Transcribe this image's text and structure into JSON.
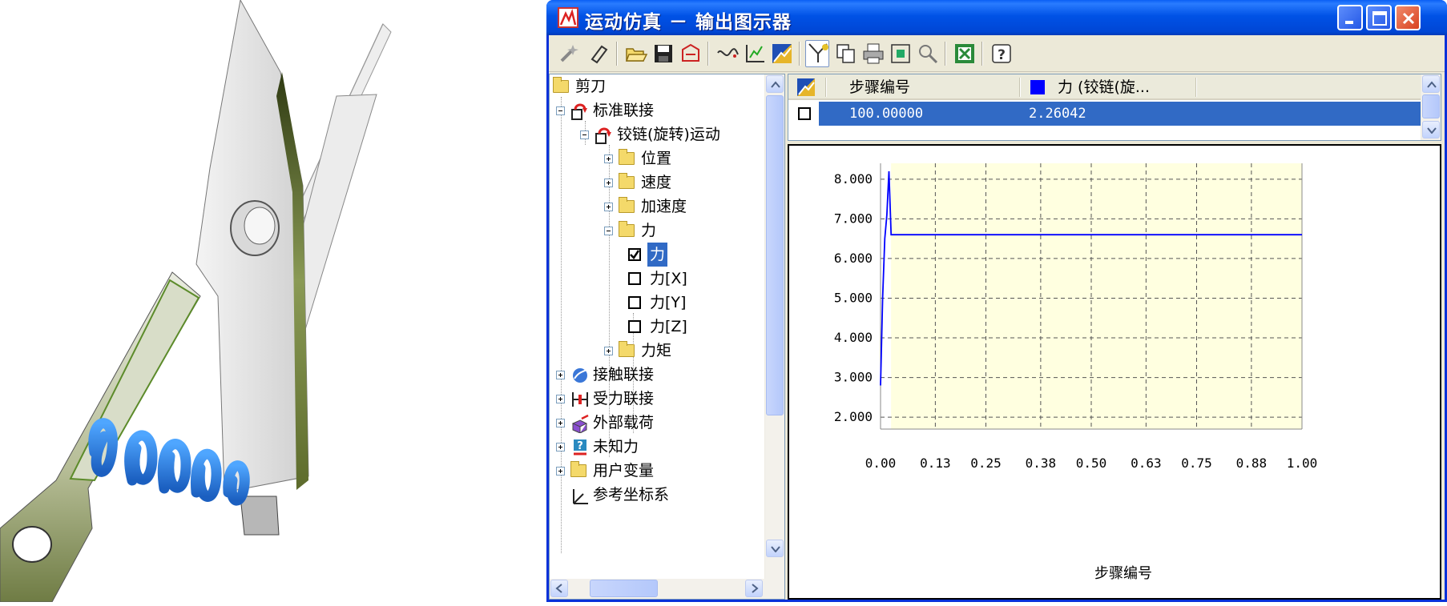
{
  "window": {
    "title": "运动仿真 － 输出图示器"
  },
  "toolbar": {
    "items": [
      "wand-icon",
      "eraser-icon",
      "open-folder-icon",
      "save-icon",
      "export-icon",
      "curve-icon",
      "axis-edit-icon",
      "chart-color-icon",
      "filter-icon",
      "copy-icon",
      "print-icon",
      "zoom-fit-icon",
      "zoom-icon",
      "excel-icon",
      "help-icon"
    ],
    "pressed": "filter-icon"
  },
  "tree": {
    "root": "剪刀",
    "items": {
      "standard_joints": "标准联接",
      "hinge": "铰链(旋转)运动",
      "position": "位置",
      "velocity": "速度",
      "acceleration": "加速度",
      "force": "力",
      "force_selected": "力",
      "force_x": "力[X]",
      "force_y": "力[Y]",
      "force_z": "力[Z]",
      "torque": "力矩",
      "contact_joints": "接触联接",
      "force_joints": "受力联接",
      "external_loads": "外部载荷",
      "unknown_force": "未知力",
      "user_variables": "用户变量",
      "ref_coords": "参考坐标系"
    }
  },
  "list": {
    "columns": [
      "步骤编号",
      "力 (铰链(旋..."
    ],
    "rows": [
      {
        "step": "100.00000",
        "value": "2.26042"
      }
    ]
  },
  "colors": {
    "accent": "#316ac5",
    "series": "#0000ff",
    "plot_bg": "#ffffe0"
  },
  "chart_data": {
    "type": "line",
    "xlabel": "步骤编号",
    "ylabel": "",
    "xlim": [
      0,
      1
    ],
    "ylim": [
      1.7,
      8.4
    ],
    "x_ticks": [
      "0.00",
      "0.13",
      "0.25",
      "0.38",
      "0.50",
      "0.63",
      "0.75",
      "0.88",
      "1.00"
    ],
    "y_ticks": [
      "2.000",
      "3.000",
      "4.000",
      "5.000",
      "6.000",
      "7.000",
      "8.000"
    ],
    "grid": true,
    "series": [
      {
        "x": [
          0.0,
          0.005,
          0.01,
          0.015,
          0.02,
          0.025,
          1.0
        ],
        "y": [
          2.8,
          5.0,
          6.5,
          7.1,
          8.2,
          6.6,
          6.6
        ]
      }
    ]
  }
}
